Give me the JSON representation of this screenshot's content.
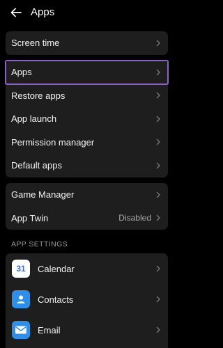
{
  "header": {
    "title": "Apps",
    "back_icon": "arrow-left-icon"
  },
  "group1": {
    "items": [
      {
        "label": "Screen time"
      }
    ]
  },
  "group2": {
    "items": [
      {
        "label": "Apps",
        "highlighted": true
      },
      {
        "label": "Restore apps"
      },
      {
        "label": "App launch"
      },
      {
        "label": "Permission manager"
      },
      {
        "label": "Default apps"
      }
    ]
  },
  "group3": {
    "items": [
      {
        "label": "Game Manager"
      },
      {
        "label": "App Twin",
        "value": "Disabled"
      }
    ]
  },
  "app_settings": {
    "section_label": "APP SETTINGS",
    "items": [
      {
        "label": "Calendar",
        "icon": "calendar-icon",
        "icon_text": "31"
      },
      {
        "label": "Contacts",
        "icon": "contacts-icon"
      },
      {
        "label": "Email",
        "icon": "email-icon"
      }
    ]
  },
  "colors": {
    "highlight": "#8d62c7",
    "card": "#1e1e1e",
    "background": "#000000"
  }
}
